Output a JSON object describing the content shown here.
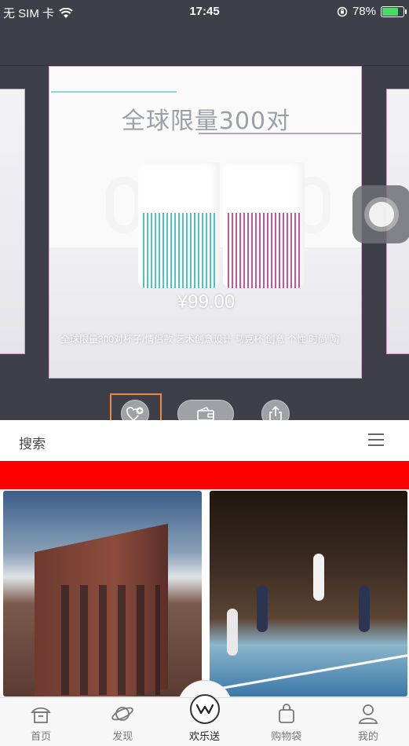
{
  "status_bar": {
    "carrier": "无 SIM 卡",
    "time": "17:45",
    "battery_percent": "78%",
    "battery_level": 0.78,
    "icons": [
      "wifi-icon",
      "rotation-lock-icon",
      "battery-icon"
    ]
  },
  "product_card": {
    "headline": "全球限量300对",
    "price": "¥99.00",
    "description": "全球限量300对杯子/情侣款 艺术创意设计 马克杯 创意 个性 时尚 陶"
  },
  "actions": {
    "icons": [
      "heart-add-icon",
      "wallet-icon",
      "share-icon"
    ]
  },
  "search": {
    "label": "搜索",
    "menu_icon": "hamburger-menu-icon"
  },
  "tabs": [
    {
      "label": "首页",
      "icon": "home-icon"
    },
    {
      "label": "发现",
      "icon": "planet-icon"
    },
    {
      "label": "欢乐送",
      "icon": "w-logo-icon"
    },
    {
      "label": "购物袋",
      "icon": "bag-icon"
    },
    {
      "label": "我的",
      "icon": "user-icon"
    }
  ],
  "colors": {
    "header_bg": "#3e4049",
    "banner_red": "#ff0000",
    "highlight_orange": "#ee8a3a",
    "battery_green": "#4cd964"
  }
}
